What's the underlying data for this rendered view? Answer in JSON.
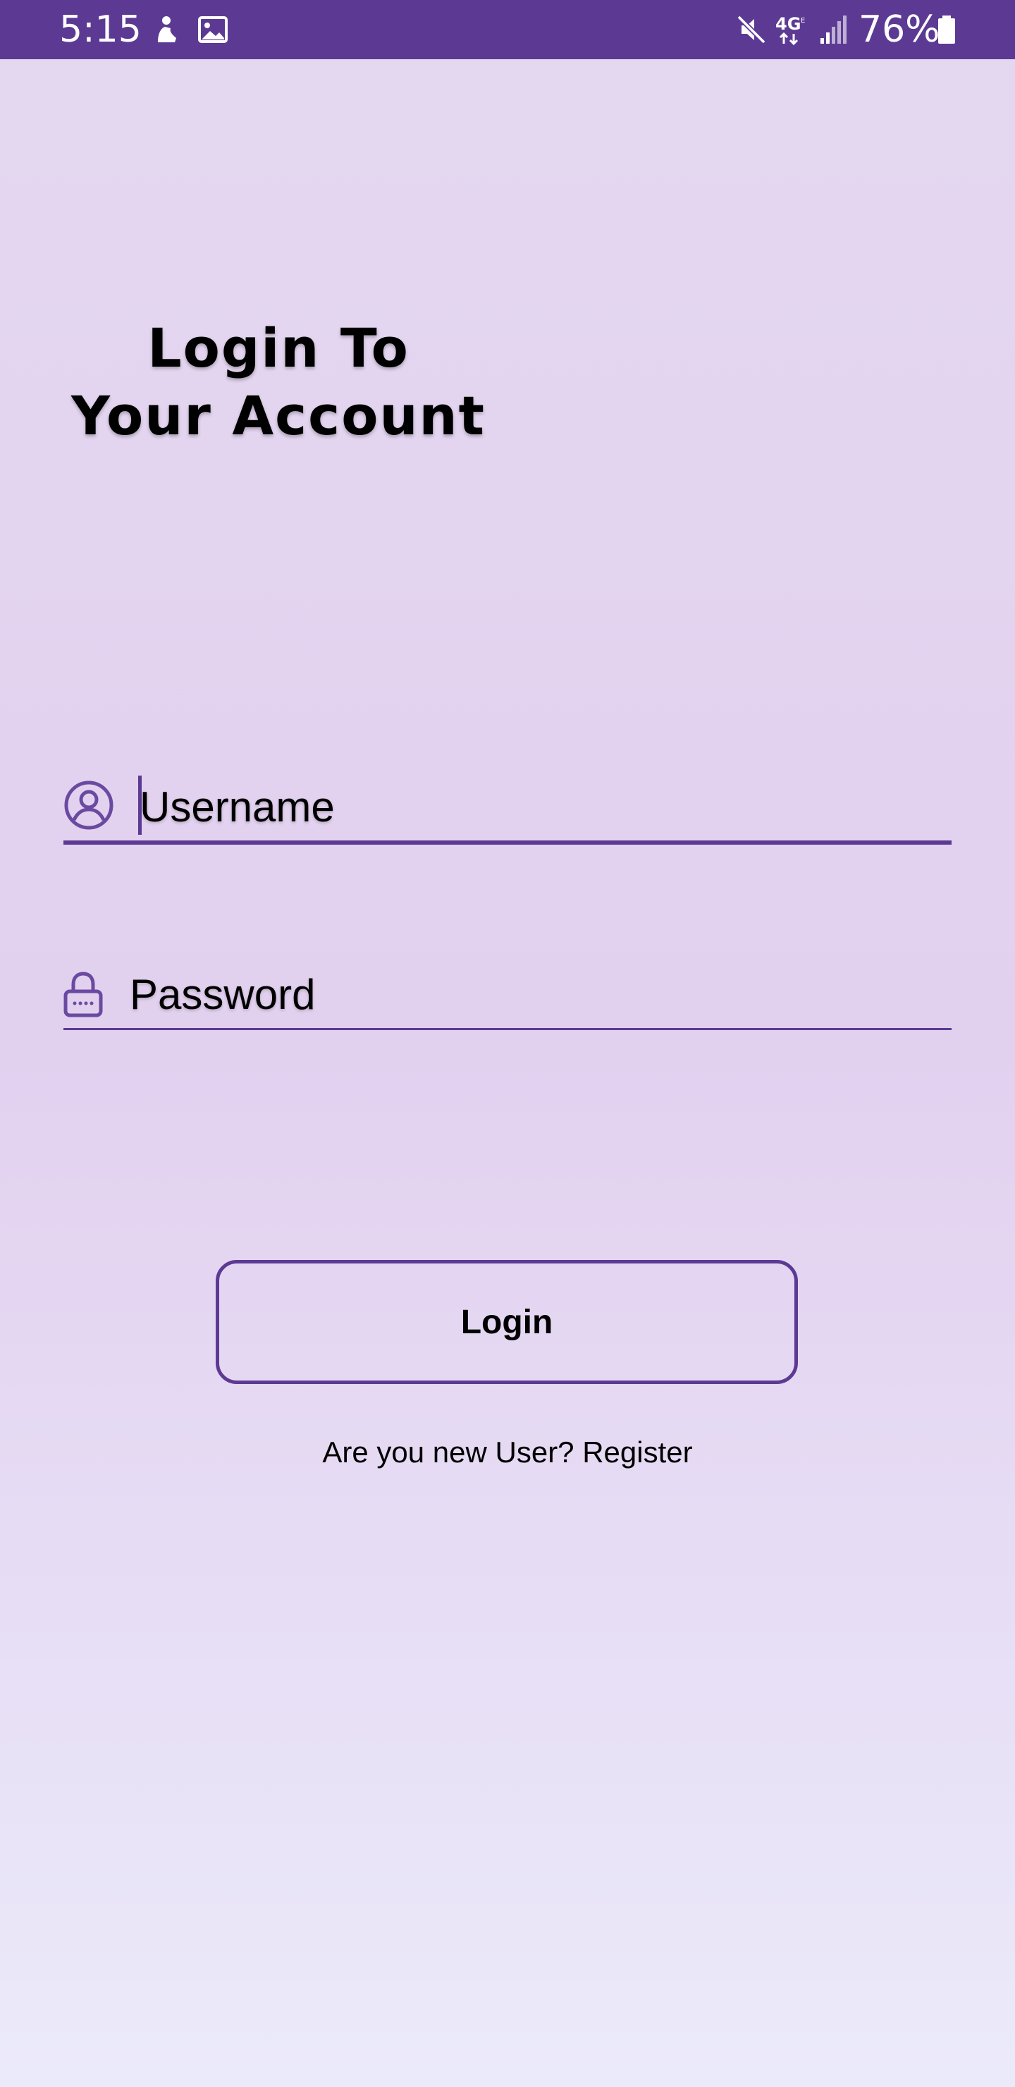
{
  "status_bar": {
    "time": "5:15",
    "battery_percent": "76%",
    "icons": [
      "notification-person-icon",
      "gallery-icon",
      "mute-icon",
      "4g-lte-icon",
      "signal-icon",
      "battery-icon"
    ],
    "background_color": "#5c3a94"
  },
  "heading": {
    "line1": "Login To",
    "line2": "Your Account"
  },
  "username": {
    "placeholder": "Username",
    "value": "",
    "icon": "account-circle-icon"
  },
  "password": {
    "placeholder": "Password",
    "value": "",
    "icon": "lock-icon"
  },
  "login_button": {
    "label": "Login"
  },
  "register_link": {
    "label": "Are you new User? Register"
  },
  "colors": {
    "accent": "#5c3a94",
    "background_top": "#e4d8f0",
    "background_bottom": "#ebeafa"
  }
}
